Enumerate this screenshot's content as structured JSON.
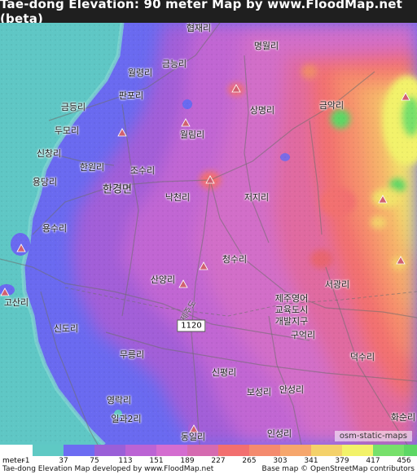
{
  "title": "Tae-dong Elevation: 90 meter Map by www.FloodMap.net (beta)",
  "map": {
    "places": [
      {
        "name": "협재리"
      },
      {
        "name": "명월리"
      },
      {
        "name": "금능리"
      },
      {
        "name": "월령리"
      },
      {
        "name": "판포리"
      },
      {
        "name": "상명리"
      },
      {
        "name": "금악리"
      },
      {
        "name": "금등리"
      },
      {
        "name": "두모리"
      },
      {
        "name": "월림리"
      },
      {
        "name": "신창리"
      },
      {
        "name": "한원리"
      },
      {
        "name": "조수리"
      },
      {
        "name": "용당리"
      },
      {
        "name": "한경면"
      },
      {
        "name": "낙천리"
      },
      {
        "name": "저지리"
      },
      {
        "name": "용수리"
      },
      {
        "name": "청수리"
      },
      {
        "name": "산양리"
      },
      {
        "name": "서광리"
      },
      {
        "name": "고산리"
      },
      {
        "name": "제주영어"
      },
      {
        "name": "교육도시"
      },
      {
        "name": "개발지구"
      },
      {
        "name": "신도리"
      },
      {
        "name": "구억리"
      },
      {
        "name": "무릉리"
      },
      {
        "name": "신평리"
      },
      {
        "name": "덕수리"
      },
      {
        "name": "보성리"
      },
      {
        "name": "안성리"
      },
      {
        "name": "영락리"
      },
      {
        "name": "일과2리"
      },
      {
        "name": "동일리"
      },
      {
        "name": "인성리"
      },
      {
        "name": "화순리"
      }
    ],
    "road_label": "제주도",
    "road_number": "1120",
    "attribution": "osm-static-maps"
  },
  "legend": {
    "unit": "meter",
    "ticks": [
      "-1",
      "37",
      "75",
      "113",
      "151",
      "189",
      "227",
      "265",
      "303",
      "341",
      "379",
      "417",
      "456"
    ],
    "colors": [
      "#5fc9c4",
      "#6c6cf2",
      "#9a5fd8",
      "#bb63d4",
      "#d46dd0",
      "#d56ab0",
      "#f26f6f",
      "#f48a6e",
      "#f6a66c",
      "#f4d16a",
      "#f2f26a",
      "#77e06b",
      "#5dd765"
    ]
  },
  "footer": {
    "left": "Tae-dong Elevation Map developed by www.FloodMap.net",
    "right": "Base map © OpenStreetMap contributors"
  }
}
